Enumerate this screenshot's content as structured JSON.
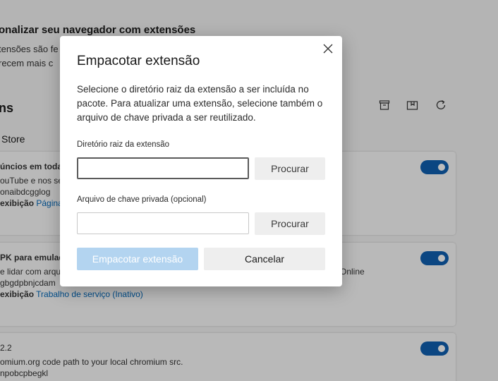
{
  "background": {
    "title": "onalizar seu navegador com extensões",
    "line1": "tensões são fe",
    "line2": "recem mais c",
    "section_title": "ns",
    "store_label": "Store",
    "cards": [
      {
        "name": "úncios em toda a",
        "desc": "ouTube e nos se",
        "id": "onaibdcgglog",
        "view_label": "exibição",
        "view_link": "Página"
      },
      {
        "name": "PK para emulado",
        "desc": "e lidar com arqu",
        "desc_right": "Online",
        "id": "gbgdpbnjcdam",
        "view_label": "exibição",
        "view_link": "Trabalho de serviço (Inativo)"
      },
      {
        "version": "2.2",
        "desc": "omium.org code path to your local chromium src.",
        "id": "npobcpbegkl"
      }
    ]
  },
  "dialog": {
    "title": "Empacotar extensão",
    "description": "Selecione o diretório raiz da extensão a ser incluída no pacote. Para atualizar uma extensão, selecione também o arquivo de chave privada a ser reutilizado.",
    "root_dir_label": "Diretório raiz da extensão",
    "root_dir_value": "",
    "root_browse_label": "Procurar",
    "private_key_label": "Arquivo de chave privada (opcional)",
    "private_key_value": "",
    "key_browse_label": "Procurar",
    "pack_button_label": "Empacotar extensão",
    "cancel_button_label": "Cancelar",
    "close_icon": "close-icon"
  },
  "colors": {
    "accent": "#0f5fb0",
    "pack_disabled": "#b3d4f0",
    "link": "#0067b8"
  }
}
